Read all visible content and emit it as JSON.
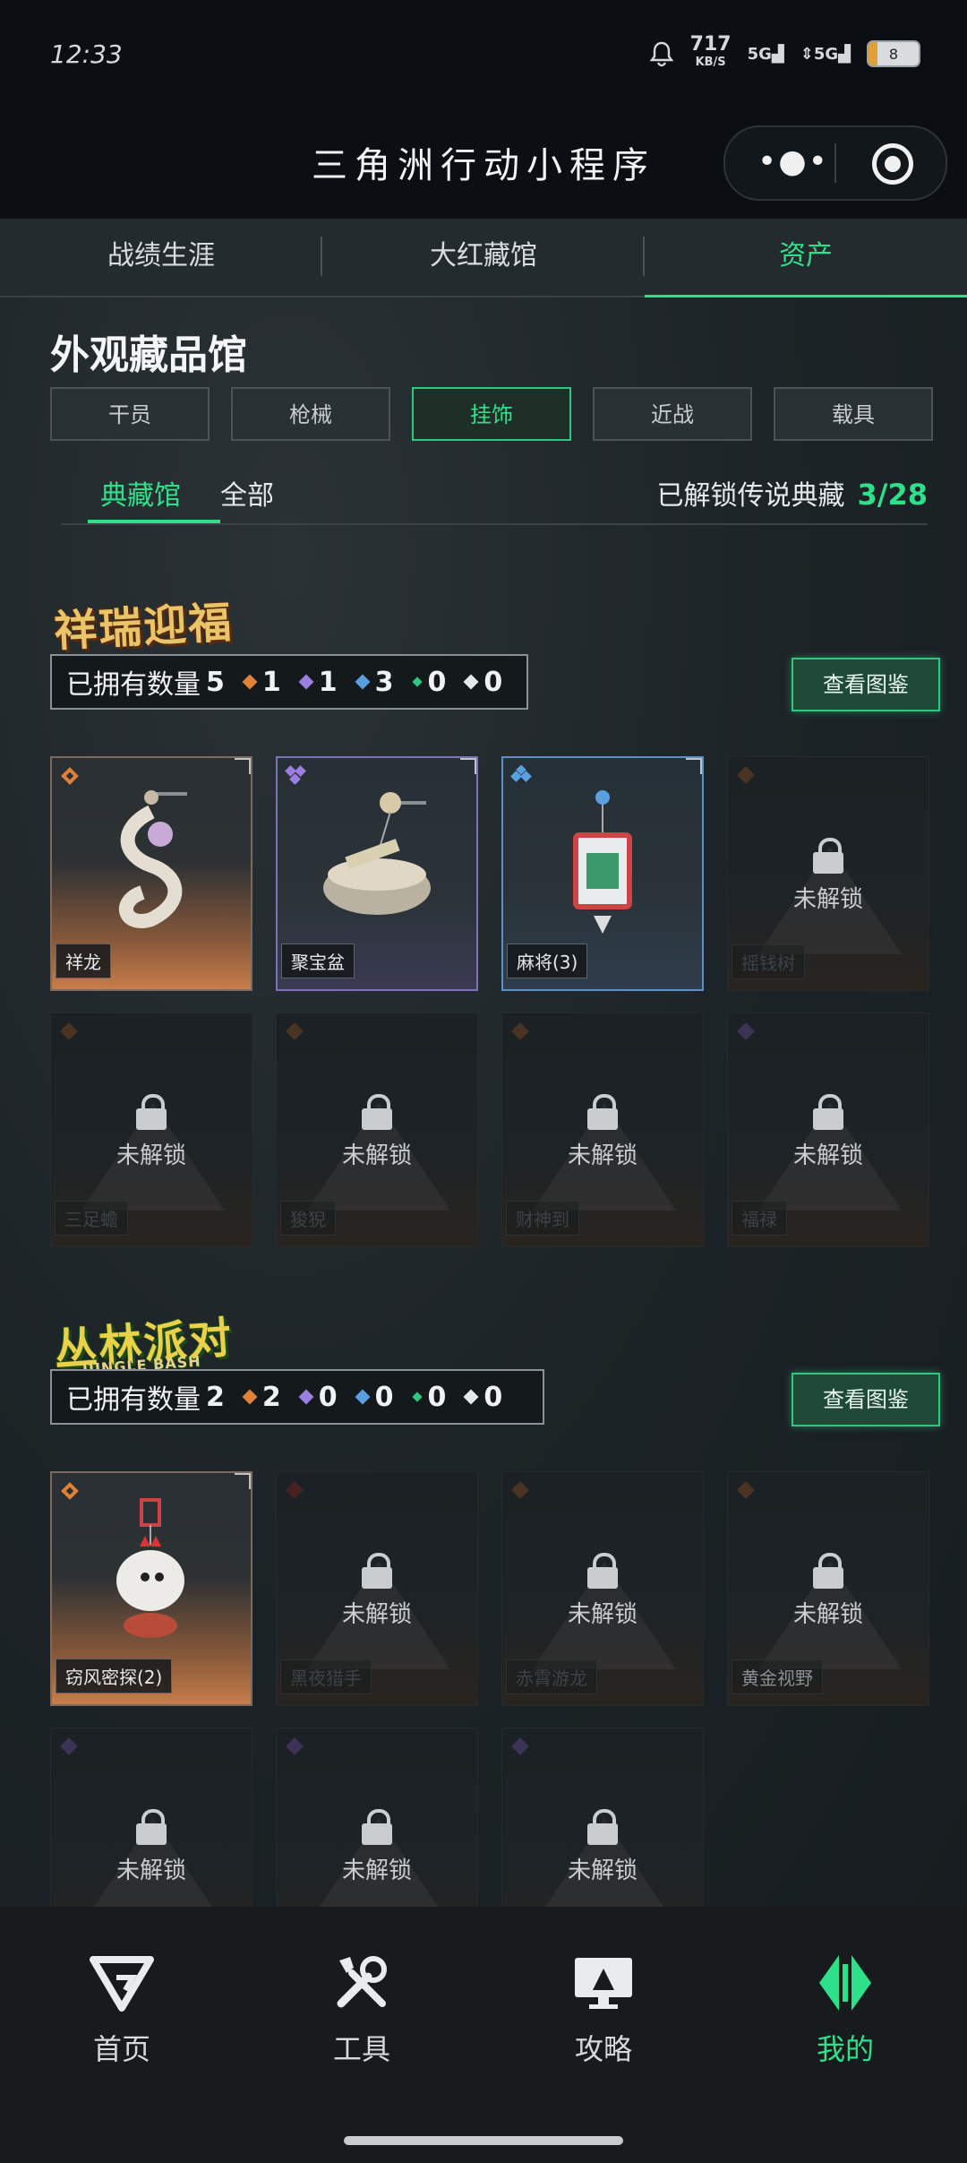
{
  "status": {
    "time": "12:33",
    "speed_value": "717",
    "speed_unit": "KB/S",
    "sig1": "5G",
    "sig2": "5G",
    "battery": "8"
  },
  "app": {
    "title": "三角洲行动小程序"
  },
  "top_tabs": [
    {
      "label": "战绩生涯"
    },
    {
      "label": "大红藏馆"
    },
    {
      "label": "资产"
    }
  ],
  "page": {
    "title": "外观藏品馆"
  },
  "categories": [
    "干员",
    "枪械",
    "挂饰",
    "近战",
    "载具"
  ],
  "sub_tabs": {
    "left": "典藏馆",
    "right": "全部",
    "unlock_label": "已解锁传说典藏",
    "unlock_count": "3/28"
  },
  "collections": [
    {
      "logo": "祥瑞迎福",
      "owned_label": "已拥有数量",
      "owned_total": "5",
      "rarity_counts": [
        "1",
        "1",
        "3",
        "0",
        "0"
      ],
      "view_button": "查看图鉴",
      "items": [
        {
          "name": "祥龙",
          "rarity": "orange",
          "owned": true
        },
        {
          "name": "聚宝盆",
          "rarity": "purple",
          "owned": true
        },
        {
          "name": "麻将(3)",
          "rarity": "blue",
          "owned": true
        },
        {
          "name": "摇钱树",
          "rarity": "orange",
          "owned": false
        },
        {
          "name": "三足蟾",
          "rarity": "orange",
          "owned": false
        },
        {
          "name": "狻猊",
          "rarity": "orange",
          "owned": false
        },
        {
          "name": "财神到",
          "rarity": "orange",
          "owned": false
        },
        {
          "name": "福禄",
          "rarity": "purple",
          "owned": false
        }
      ]
    },
    {
      "logo": "丛林派对",
      "logo_tagline": "JUNGLE BASH",
      "owned_label": "已拥有数量",
      "owned_total": "2",
      "rarity_counts": [
        "2",
        "0",
        "0",
        "0",
        "0"
      ],
      "view_button": "查看图鉴",
      "items": [
        {
          "name": "窃风密探(2)",
          "rarity": "orange",
          "owned": true
        },
        {
          "name": "黑夜猎手",
          "rarity": "red",
          "owned": false
        },
        {
          "name": "赤霄游龙",
          "rarity": "orange",
          "owned": false
        },
        {
          "name": "黄金视野",
          "rarity": "orange",
          "owned": false
        },
        {
          "name": "",
          "rarity": "purple",
          "owned": false
        },
        {
          "name": "",
          "rarity": "purple",
          "owned": false
        },
        {
          "name": "",
          "rarity": "purple",
          "owned": false
        }
      ]
    }
  ],
  "locked_text": "未解锁",
  "bottom_nav": [
    {
      "label": "首页",
      "icon": "delta-logo-icon"
    },
    {
      "label": "工具",
      "icon": "tools-icon"
    },
    {
      "label": "攻略",
      "icon": "guide-monitor-icon"
    },
    {
      "label": "我的",
      "icon": "profile-diamond-icon"
    }
  ],
  "colors": {
    "accent": "#2ee08a",
    "orange": "#e0813a",
    "purple": "#9b7ee0",
    "blue": "#5aa0e0",
    "green": "#2ec87e",
    "white": "#e6e9eb"
  }
}
